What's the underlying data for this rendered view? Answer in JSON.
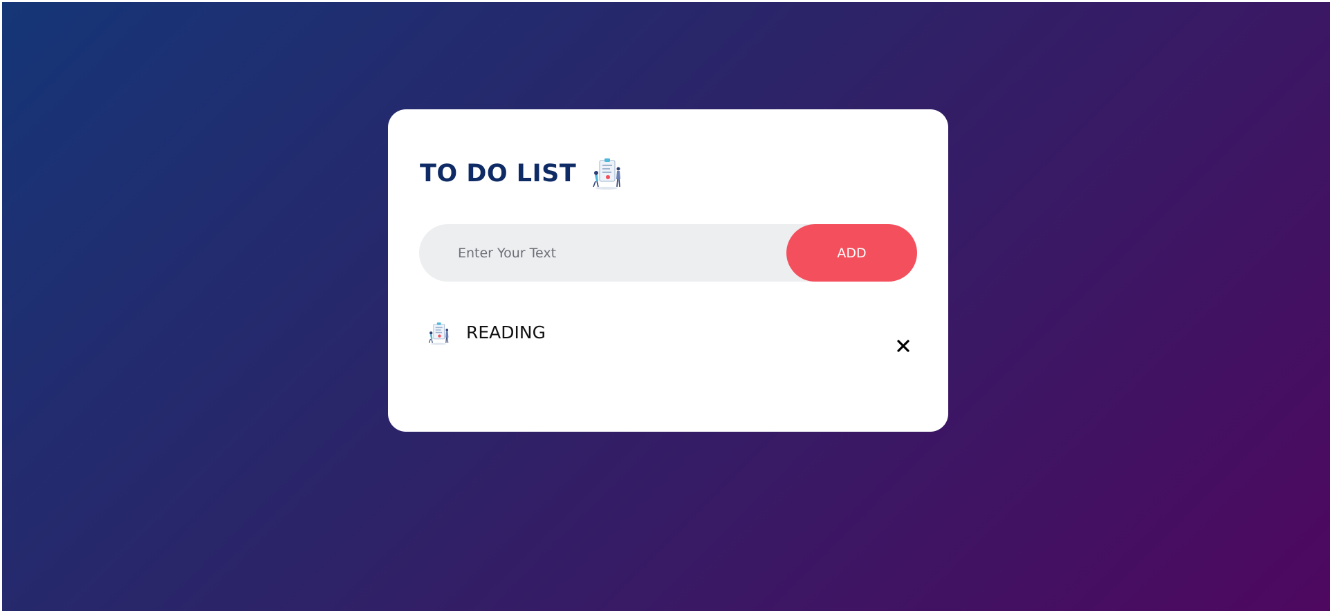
{
  "app": {
    "title": "TO DO LIST",
    "title_icon": "todo-illustration-icon"
  },
  "input": {
    "value": "",
    "placeholder": "Enter Your Text",
    "add_label": "ADD"
  },
  "tasks": [
    {
      "label": "READING",
      "icon": "todo-illustration-icon",
      "delete_icon": "close-icon"
    }
  ],
  "colors": {
    "background_start": "#153677",
    "background_end": "#4e085f",
    "title": "#0e2b66",
    "add_button": "#f44f5c",
    "input_background": "#edeef0",
    "card": "#ffffff"
  }
}
